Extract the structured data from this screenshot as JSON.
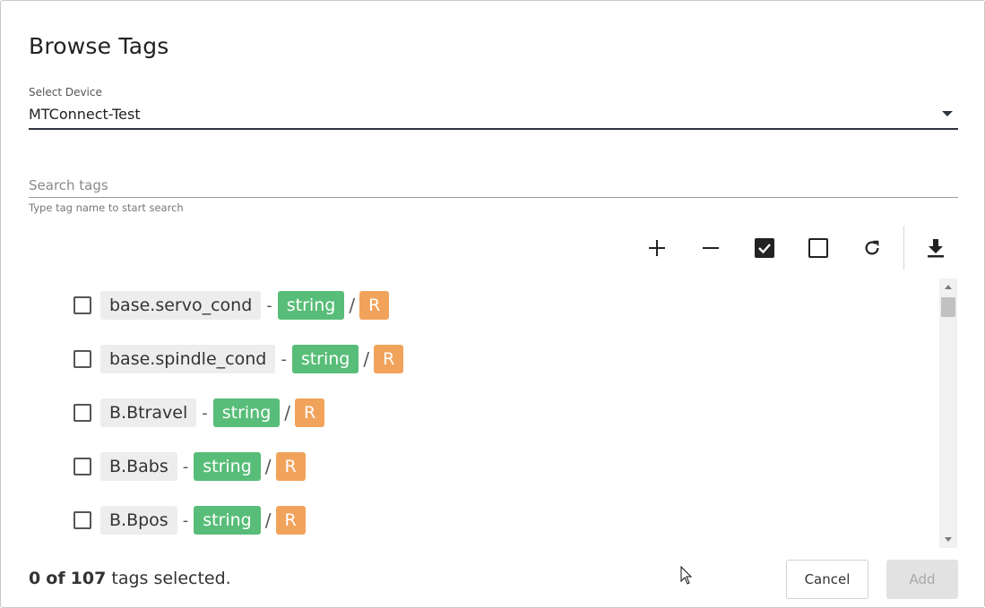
{
  "dialog": {
    "title": "Browse Tags"
  },
  "device_select": {
    "label": "Select Device",
    "value": "MTConnect-Test"
  },
  "search": {
    "placeholder": "Search tags",
    "value": "",
    "hint": "Type tag name to start search"
  },
  "toolbar": {
    "icons": [
      "plus-icon",
      "minus-icon",
      "check-all-icon",
      "uncheck-all-icon",
      "refresh-icon",
      "download-icon"
    ]
  },
  "tags": [
    {
      "name": "base.servo_cond",
      "type": "string",
      "access": "R",
      "checked": false
    },
    {
      "name": "base.spindle_cond",
      "type": "string",
      "access": "R",
      "checked": false
    },
    {
      "name": "B.Btravel",
      "type": "string",
      "access": "R",
      "checked": false
    },
    {
      "name": "B.Babs",
      "type": "string",
      "access": "R",
      "checked": false
    },
    {
      "name": "B.Bpos",
      "type": "string",
      "access": "R",
      "checked": false
    }
  ],
  "separators": {
    "dash": "-",
    "slash": "/"
  },
  "footer": {
    "selected_count": "0",
    "total_count": "107",
    "of_text": "of",
    "suffix": "tags selected.",
    "cancel_label": "Cancel",
    "add_label": "Add"
  },
  "colors": {
    "type_badge": "#58bd78",
    "access_badge": "#f2a35b",
    "tag_name_bg": "#ededed",
    "underline_active": "#2f3440"
  }
}
